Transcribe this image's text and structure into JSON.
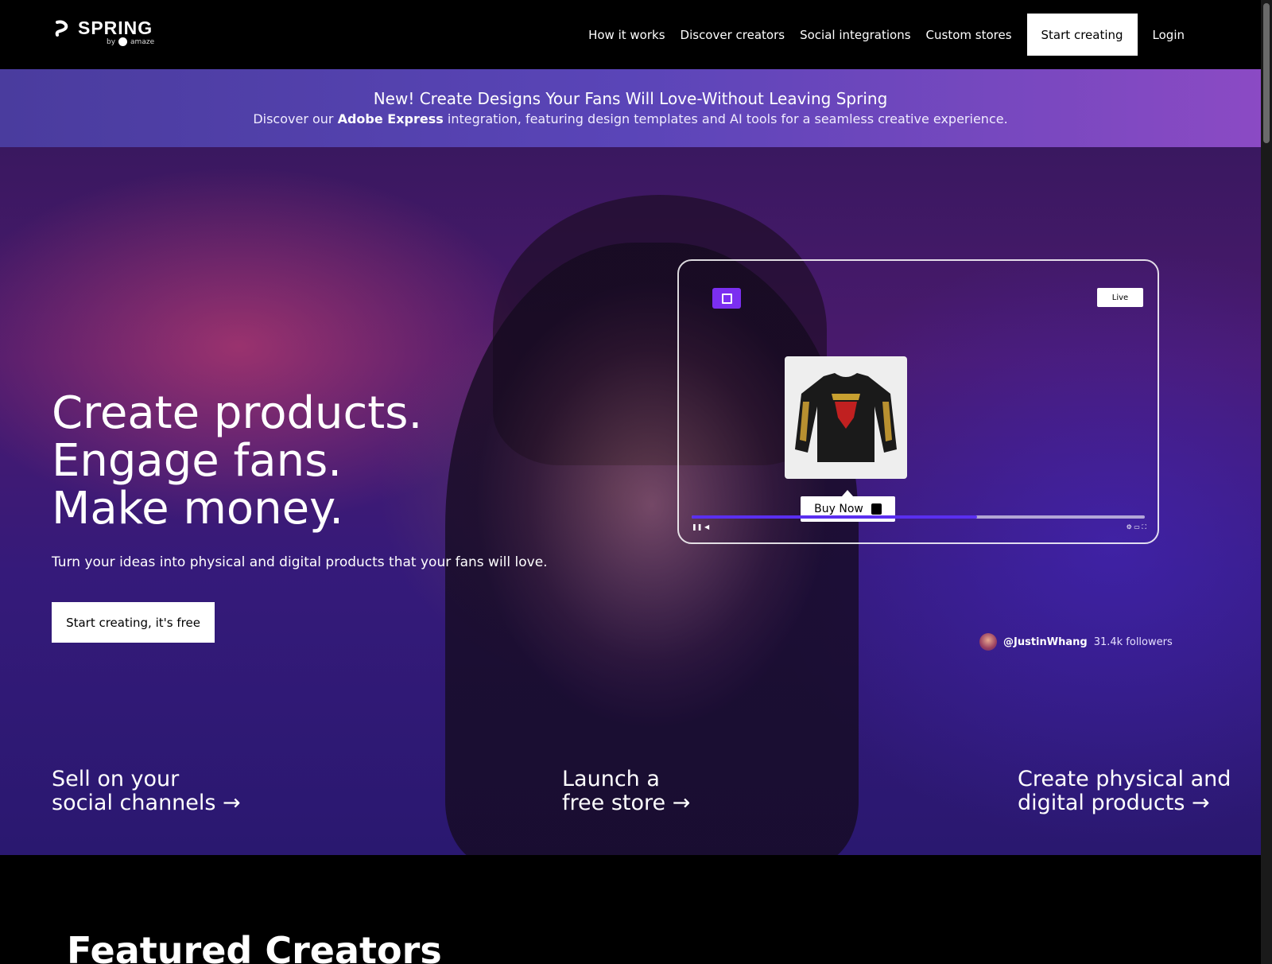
{
  "nav": {
    "logo_text": "SPRING",
    "logo_sub_by": "by",
    "logo_sub_brand": "amaze",
    "links": [
      "How it works",
      "Discover creators",
      "Social integrations",
      "Custom stores"
    ],
    "cta": "Start creating",
    "login": "Login"
  },
  "banner": {
    "title": "New! Create Designs Your Fans Will Love-Without Leaving Spring",
    "sub_pre": "Discover our ",
    "sub_bold": "Adobe Express",
    "sub_post": " integration, featuring design templates and AI tools for a seamless creative experience."
  },
  "hero": {
    "headline": [
      "Create products.",
      "Engage fans.",
      "Make money."
    ],
    "subtitle": "Turn your ideas into physical and digital products that your fans will love.",
    "cta": "Start creating, it's free",
    "stream": {
      "live_label": "Live",
      "buy_now": "Buy Now",
      "progress_fraction": 0.63
    },
    "creator": {
      "handle": "@JustinWhang",
      "followers": "31.4k followers"
    },
    "links": [
      {
        "line1": "Sell on your",
        "line2": "social channels →"
      },
      {
        "line1": "Launch a",
        "line2": "free store →"
      },
      {
        "line1": "Create physical and",
        "line2": "digital products →"
      }
    ]
  },
  "featured": {
    "title": "Featured Creators"
  },
  "colors": {
    "accent": "#5a2ff0",
    "twitch": "#7b2ff0",
    "banner_start": "#4a3c9e",
    "banner_end": "#8b4ac4"
  }
}
